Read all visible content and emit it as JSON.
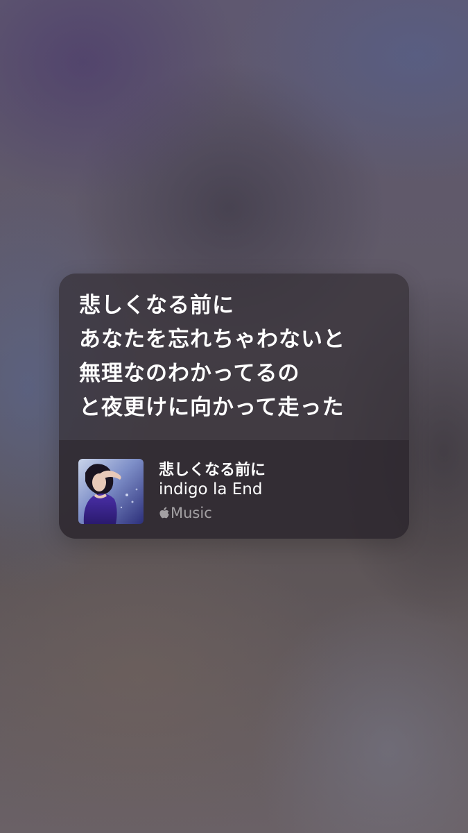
{
  "card": {
    "lyrics": [
      "悲しくなる前に",
      "あなたを忘れちゃわないと",
      "無理なのわかってるの",
      "と夜更けに向かって走った"
    ]
  },
  "song": {
    "title": "悲しくなる前に",
    "artist": "indigo la End",
    "service_label": "Music",
    "service_icon": "apple-logo-icon",
    "artwork_icon": "album-artwork"
  },
  "colors": {
    "text": "#ffffff",
    "secondary_text": "rgba(255,255,255,0.55)",
    "card_background": "rgba(54,48,56,0.72)"
  }
}
